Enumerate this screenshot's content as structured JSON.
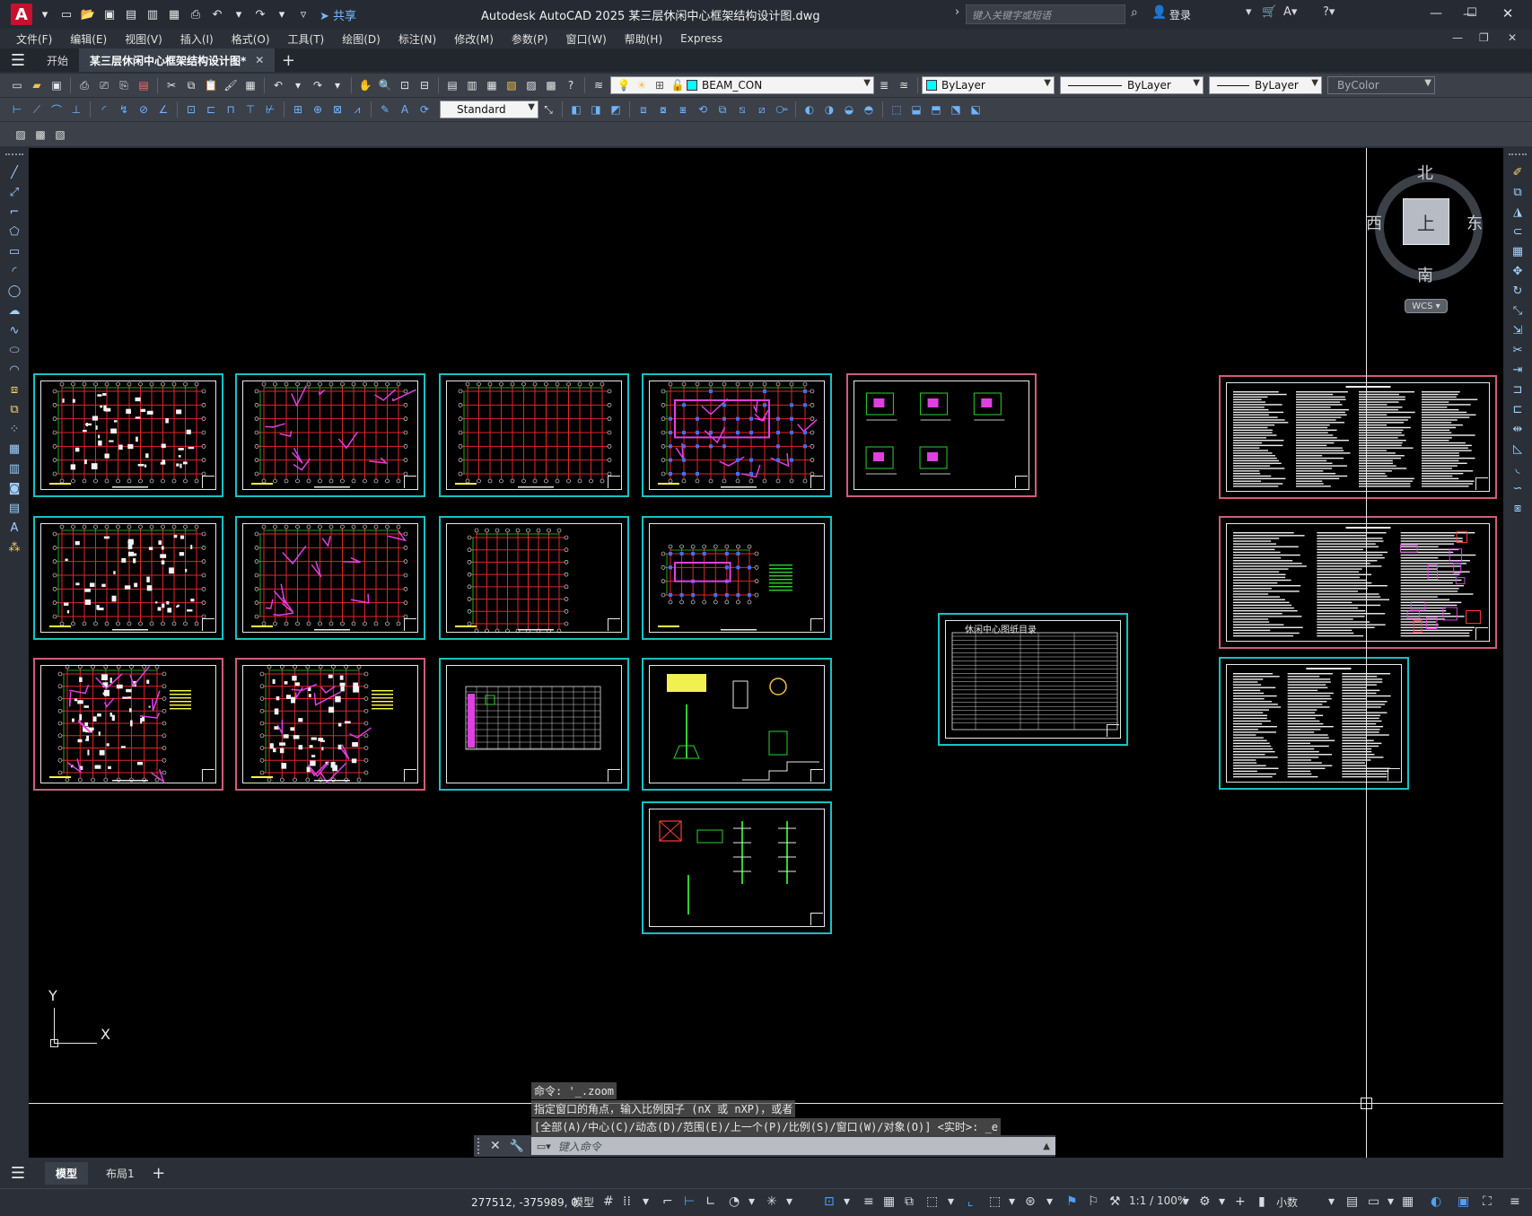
{
  "titlebar": {
    "app_logo": "A",
    "share_label": "共享",
    "title": "Autodesk AutoCAD 2025    某三层休闲中心框架结构设计图.dwg",
    "search_placeholder": "键入关键字或短语",
    "login_label": "登录"
  },
  "menu": {
    "items": [
      "文件(F)",
      "编辑(E)",
      "视图(V)",
      "插入(I)",
      "格式(O)",
      "工具(T)",
      "绘图(D)",
      "标注(N)",
      "修改(M)",
      "参数(P)",
      "窗口(W)",
      "帮助(H)",
      "Express"
    ]
  },
  "tabs": {
    "start": "开始",
    "active_doc": "某三层休闲中心框架结构设计图*"
  },
  "properties": {
    "layer_name": "BEAM_CON",
    "color": "ByLayer",
    "linetype": "ByLayer",
    "lineweight": "ByLayer",
    "plotstyle": "ByColor",
    "text_style": "Standard"
  },
  "viewcube": {
    "top_label": "上",
    "north": "北",
    "south": "南",
    "east": "东",
    "west": "西",
    "wcs_label": "WCS"
  },
  "ucs": {
    "y_label": "Y",
    "x_label": "X"
  },
  "sheets": {
    "directory_title": "休闲中心图纸目录"
  },
  "command": {
    "history": [
      "命令: '_.zoom",
      "指定窗口的角点，输入比例因子 (nX 或 nXP)，或者",
      "[全部(A)/中心(C)/动态(D)/范围(E)/上一个(P)/比例(S)/窗口(W)/对象(O)] <实时>: _e"
    ],
    "input_placeholder": "键入命令"
  },
  "layout_tabs": {
    "model": "模型",
    "layout1": "布局1"
  },
  "status": {
    "coords": "277512, -375989, 0",
    "model_label": "模型",
    "scale": "1:1 / 100%",
    "units": "小数"
  },
  "colors": {
    "canvas_bg": "#000000",
    "sheet_cyan": "#17c2c2",
    "sheet_pink": "#d35b7a",
    "grid_red": "#e0262a",
    "axis_green": "#2ed12e",
    "beam_magenta": "#e040e0",
    "column_blue": "#3f6fff"
  }
}
